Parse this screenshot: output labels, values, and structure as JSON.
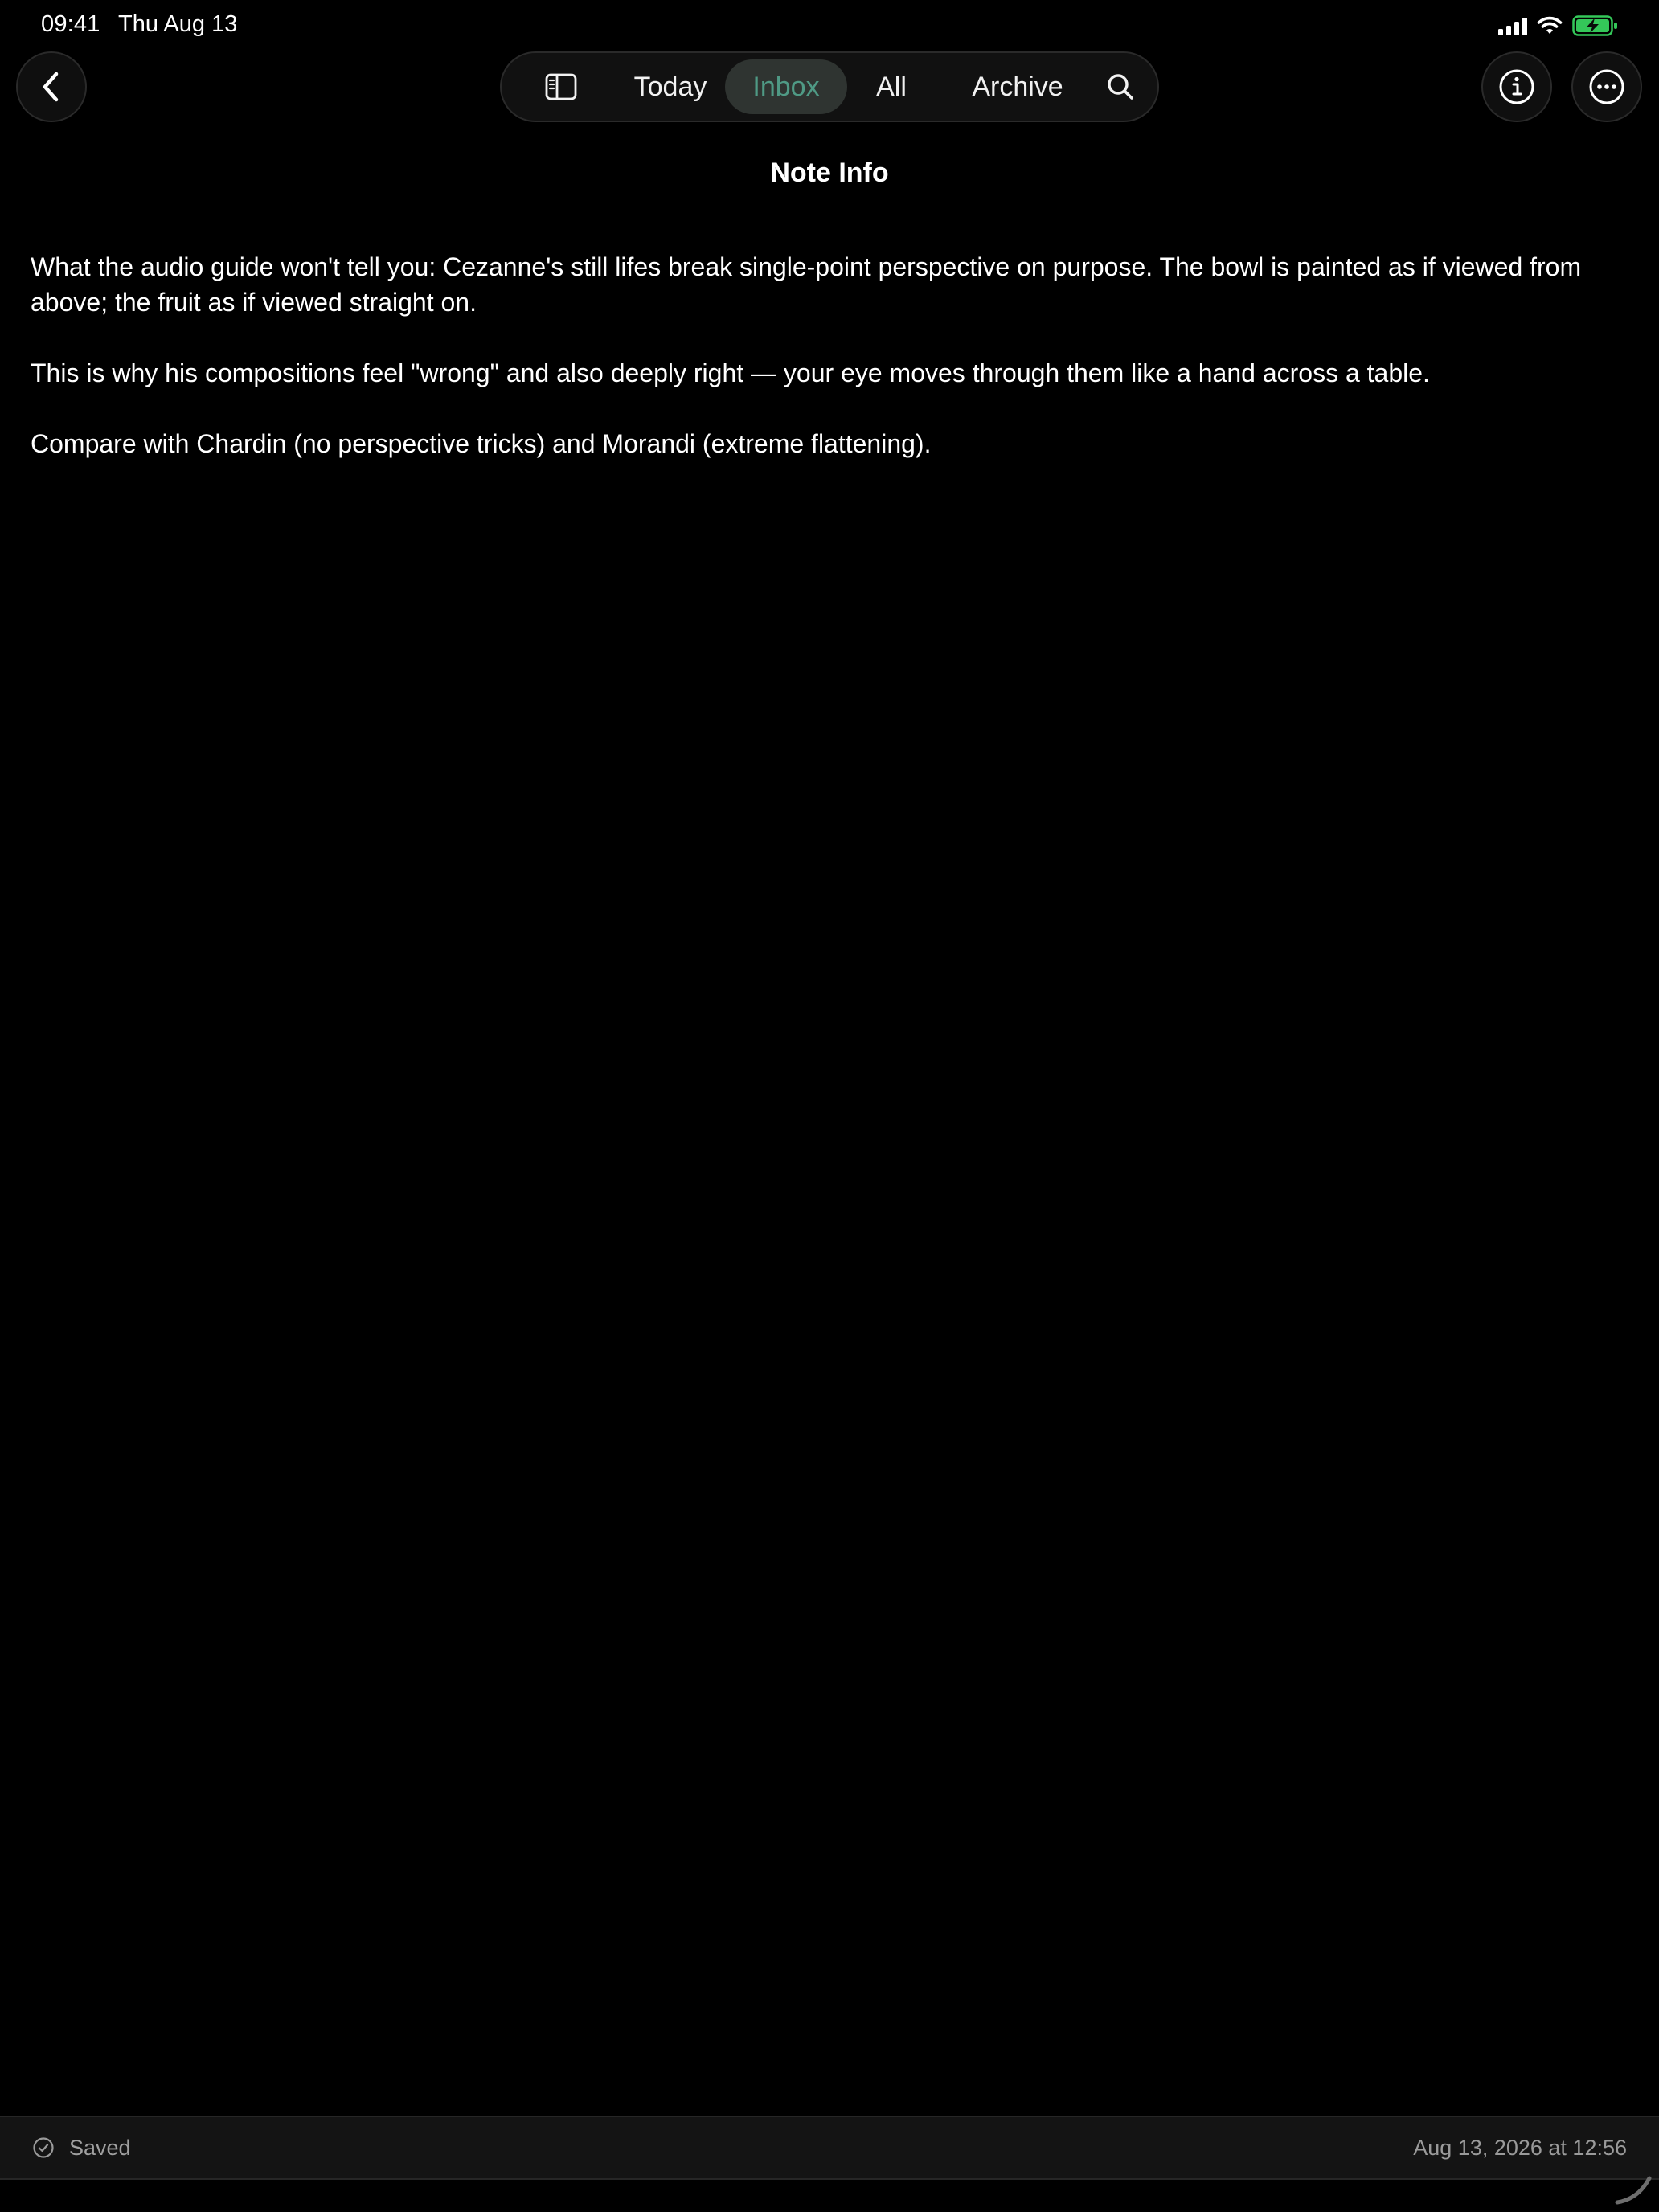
{
  "status_bar": {
    "time": "09:41",
    "date": "Thu Aug 13",
    "battery_color": "#34c759"
  },
  "nav": {
    "tabs": [
      {
        "label": "Today"
      },
      {
        "label": "Inbox",
        "selected": true
      },
      {
        "label": "All"
      },
      {
        "label": "Archive"
      }
    ],
    "accent_color": "#4f9a85"
  },
  "page": {
    "title": "Note Info"
  },
  "note": {
    "paragraphs": [
      "What the audio guide won't tell you: Cezanne's still lifes break single-point perspective on purpose. The bowl is painted as if viewed from above; the fruit as if viewed straight on.",
      "This is why his compositions feel \"wrong\" and also deeply right — your eye moves through them like a hand across a table.",
      "Compare with Chardin (no perspective tricks) and Morandi (extreme flattening)."
    ]
  },
  "footer": {
    "status": "Saved",
    "timestamp": "Aug 13, 2026 at 12:56"
  },
  "icons": {
    "back": "chevron-left-icon",
    "sidebar": "sidebar-toggle-icon",
    "search": "search-icon",
    "info": "info-icon",
    "more": "ellipsis-icon",
    "saved": "checkmark-circle-icon"
  }
}
